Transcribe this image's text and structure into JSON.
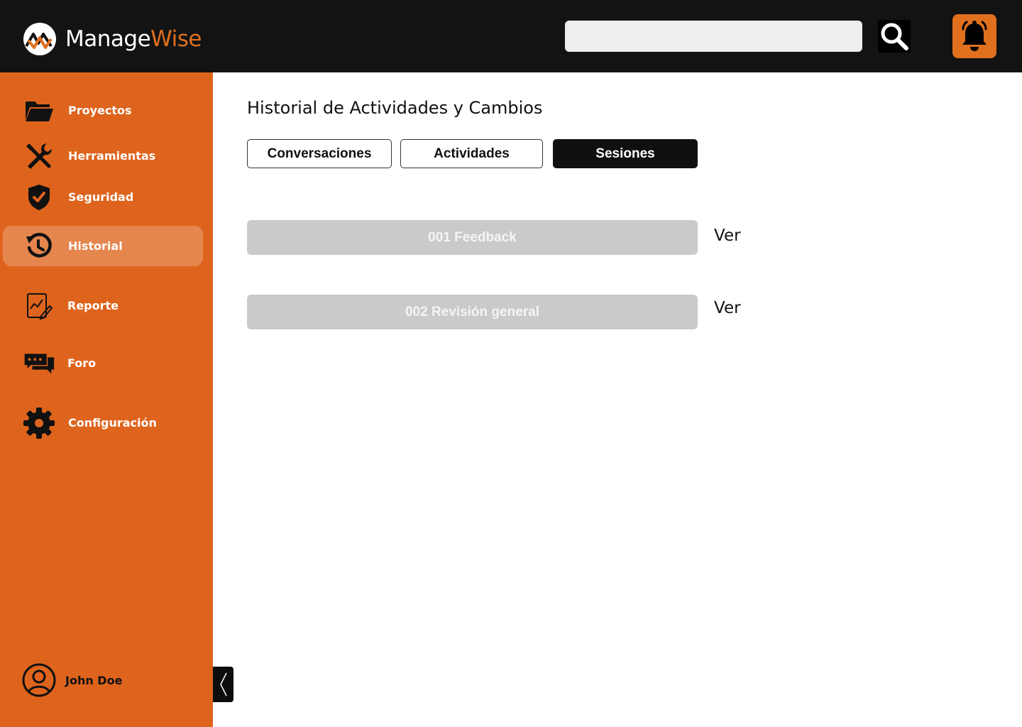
{
  "header": {
    "logo": {
      "part1": "Manage",
      "part2": "Wise"
    },
    "search": {
      "value": "",
      "placeholder": ""
    },
    "colors": {
      "background": "#131313",
      "accent": "#e0701e"
    }
  },
  "sidebar": {
    "background": "#de641d",
    "items": [
      {
        "label": "Proyectos",
        "icon": "folder-icon",
        "active": false
      },
      {
        "label": "Herramientas",
        "icon": "tools-icon",
        "active": false
      },
      {
        "label": "Seguridad",
        "icon": "shield-check-icon",
        "active": false
      },
      {
        "label": "Historial",
        "icon": "history-icon",
        "active": true
      },
      {
        "label": "Reporte",
        "icon": "report-icon",
        "active": false
      },
      {
        "label": "Foro",
        "icon": "chat-bubbles-icon",
        "active": false
      },
      {
        "label": "Configuración",
        "icon": "gear-icon",
        "active": false
      }
    ],
    "user": {
      "name": "John Doe",
      "icon": "user-avatar-icon"
    }
  },
  "main": {
    "title": "Historial de Actividades y Cambios",
    "tabs": [
      {
        "label": "Conversaciones",
        "active": false
      },
      {
        "label": "Actividades",
        "active": false
      },
      {
        "label": "Sesiones",
        "active": true
      }
    ],
    "sessions": [
      {
        "label": "001 Feedback",
        "action": "Ver"
      },
      {
        "label": "002 Revisión general",
        "action": "Ver"
      }
    ]
  }
}
